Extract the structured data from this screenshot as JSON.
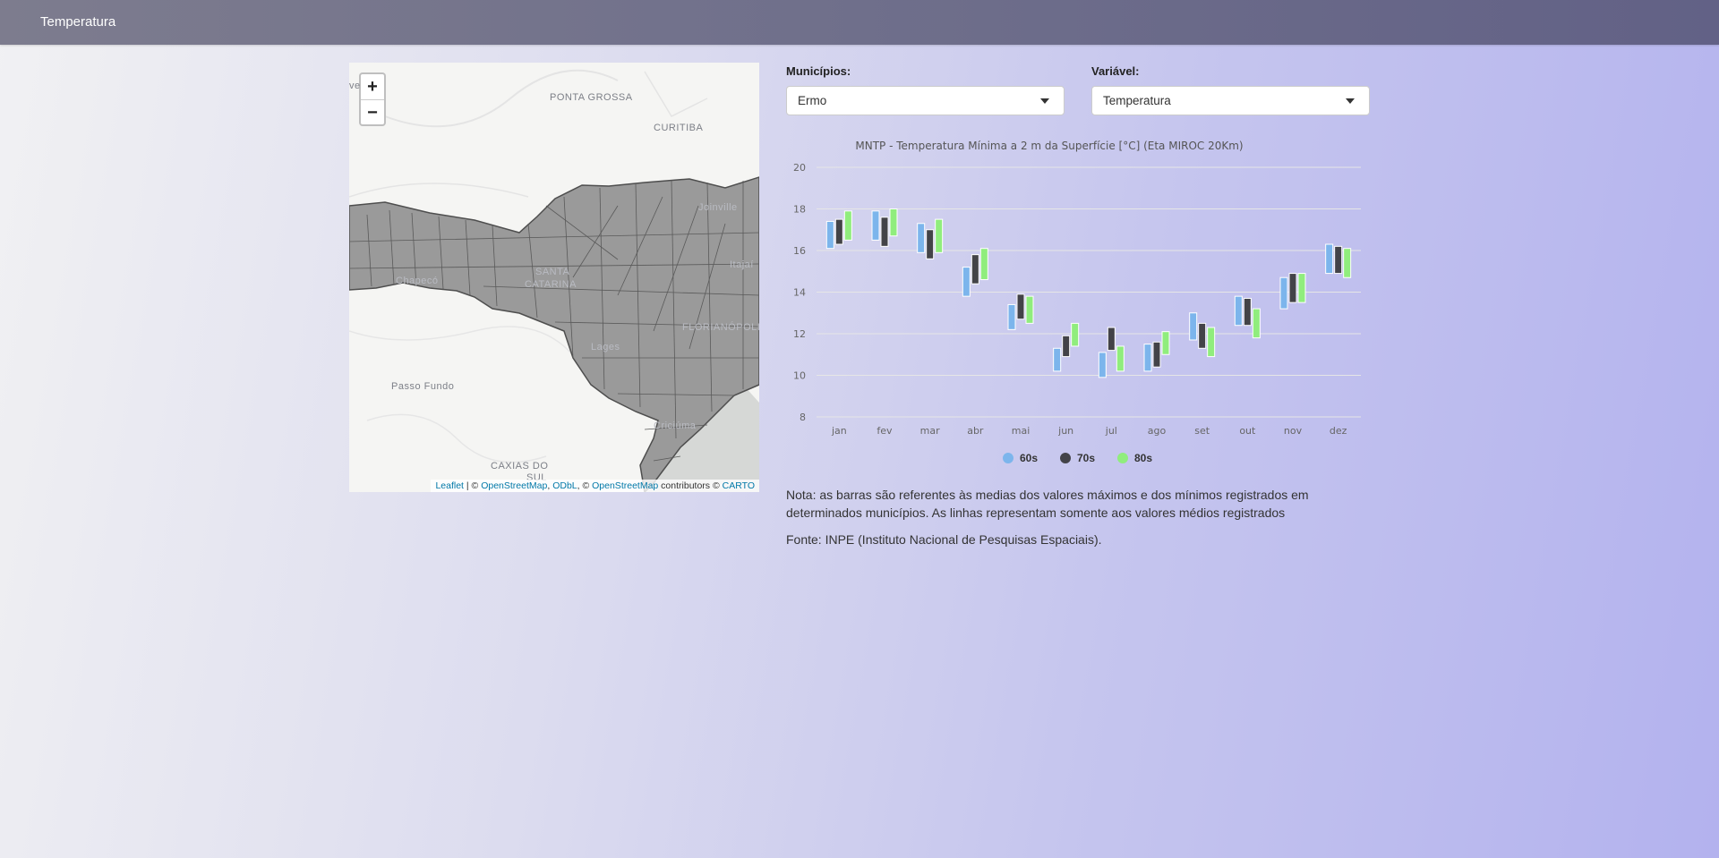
{
  "navbar": {
    "title": "Temperatura"
  },
  "map": {
    "zoom_in": "+",
    "zoom_out": "−",
    "labels": {
      "ponta_grossa": "PONTA GROSSA",
      "curitiba": "CURITIBA",
      "joinville": "Joinville",
      "itajai": "Itajaí",
      "santa_catarina_1": "SANTA",
      "santa_catarina_2": "CATARINA",
      "chapeco": "Chapecó",
      "lages": "Lages",
      "florianopolis": "FLORIANÓPOLIS",
      "passo_fundo": "Passo Fundo",
      "criciuma": "Criciúma",
      "caxias_1": "CAXIAS DO",
      "caxias_2": "SUL",
      "left_edge": "ve"
    },
    "attribution": {
      "leaflet": "Leaflet",
      "sep1": " | © ",
      "osm1": "OpenStreetMap",
      "comma": ", ",
      "odbl": "ODbL",
      "sep2": ", © ",
      "osm2": "OpenStreetMap",
      "contrib": " contributors © ",
      "carto": "CARTO"
    },
    "colors": {
      "region": "#9a9a9a",
      "border": "#505050",
      "sea": "#d6d8d6",
      "land": "#f5f5f3"
    }
  },
  "controls": {
    "municipios": {
      "label": "Municípios:",
      "value": "Ermo"
    },
    "variavel": {
      "label": "Variável:",
      "value": "Temperatura"
    }
  },
  "chart_data": {
    "type": "bar",
    "subtype": "floating-range",
    "title": "MNTP - Temperatura Mínima a 2 m da Superfície [°C] (Eta MIROC 20Km)",
    "categories": [
      "jan",
      "fev",
      "mar",
      "abr",
      "mai",
      "jun",
      "jul",
      "ago",
      "set",
      "out",
      "nov",
      "dez"
    ],
    "ylim": [
      8,
      20
    ],
    "yticks": [
      8,
      10,
      12,
      14,
      16,
      18,
      20
    ],
    "grid": true,
    "legend_position": "bottom",
    "series": [
      {
        "name": "60s",
        "color": "#7cb5ec",
        "low": [
          16.1,
          16.5,
          15.9,
          13.8,
          12.2,
          10.2,
          9.9,
          10.2,
          11.7,
          12.4,
          13.2,
          14.9
        ],
        "high": [
          17.4,
          17.9,
          17.3,
          15.2,
          13.4,
          11.3,
          11.1,
          11.5,
          13.0,
          13.8,
          14.7,
          16.3
        ]
      },
      {
        "name": "70s",
        "color": "#434348",
        "low": [
          16.3,
          16.2,
          15.6,
          14.4,
          12.7,
          10.9,
          11.2,
          10.4,
          11.3,
          12.4,
          13.5,
          14.9
        ],
        "high": [
          17.5,
          17.6,
          17.0,
          15.8,
          13.9,
          11.9,
          12.3,
          11.6,
          12.5,
          13.7,
          14.9,
          16.2
        ]
      },
      {
        "name": "80s",
        "color": "#90ed7d",
        "low": [
          16.5,
          16.7,
          15.9,
          14.6,
          12.5,
          11.4,
          10.2,
          11.0,
          10.9,
          11.8,
          13.5,
          14.7
        ],
        "high": [
          17.9,
          18.0,
          17.5,
          16.1,
          13.8,
          12.5,
          11.4,
          12.1,
          12.3,
          13.2,
          14.9,
          16.1
        ]
      }
    ]
  },
  "notes": {
    "nota_line1": "Nota: as barras são referentes às medias dos valores máximos e dos mínimos registrados em",
    "nota_line2": "determinados municípios. As linhas representam somente aos valores médios registrados",
    "fonte": "Fonte: INPE (Instituto Nacional de Pesquisas Espaciais)."
  }
}
